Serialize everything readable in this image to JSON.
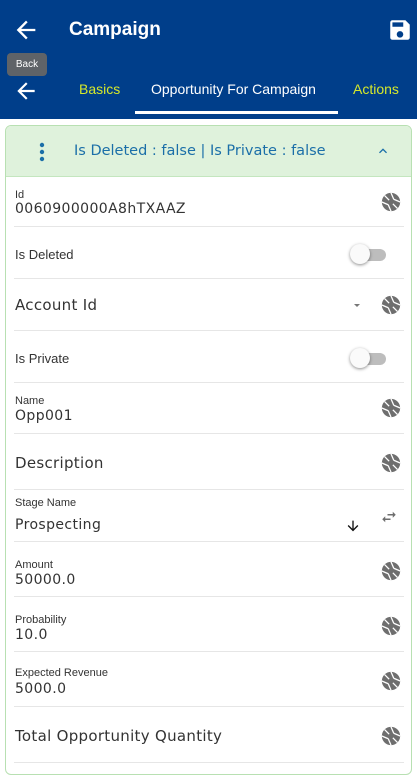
{
  "appbar": {
    "title": "Campaign",
    "back_tooltip": "Back"
  },
  "tabs": [
    {
      "label": "Basics",
      "active": false
    },
    {
      "label": "Opportunity For Campaign",
      "active": true
    },
    {
      "label": "Actions",
      "active": false
    }
  ],
  "card": {
    "summary": "Is Deleted  : false | Is Private  : false"
  },
  "fields": {
    "id": {
      "label": "Id",
      "value": "0060900000A8hTXAAZ"
    },
    "is_deleted": {
      "label": "Is Deleted",
      "checked": false
    },
    "account_id": {
      "label": "Account Id"
    },
    "is_private": {
      "label": "Is Private",
      "checked": false
    },
    "name": {
      "label": "Name",
      "value": "Opp001"
    },
    "description": {
      "label": "Description"
    },
    "stage_name": {
      "label": "Stage Name",
      "value": "Prospecting"
    },
    "amount": {
      "label": "Amount",
      "value": "50000.0"
    },
    "probability": {
      "label": "Probability",
      "value": "10.0"
    },
    "expected_revenue": {
      "label": "Expected Revenue",
      "value": "5000.0"
    },
    "total_opportunity_quantity": {
      "label": "Total Opportunity Quantity"
    }
  },
  "colors": {
    "primary": "#003e8a",
    "tab_inactive": "#d6e82a",
    "card_header": "#dff2dc",
    "summary_text": "#1b6fa8"
  },
  "icons": {
    "back": "arrow-left-icon",
    "save": "floppy-disk-icon",
    "menu": "vertical-dots-icon",
    "collapse": "chevron-up-icon",
    "field_action": "aperture-icon",
    "dropdown": "caret-down-icon",
    "sort": "arrow-down-icon",
    "swap": "swap-horizontal-icon"
  }
}
